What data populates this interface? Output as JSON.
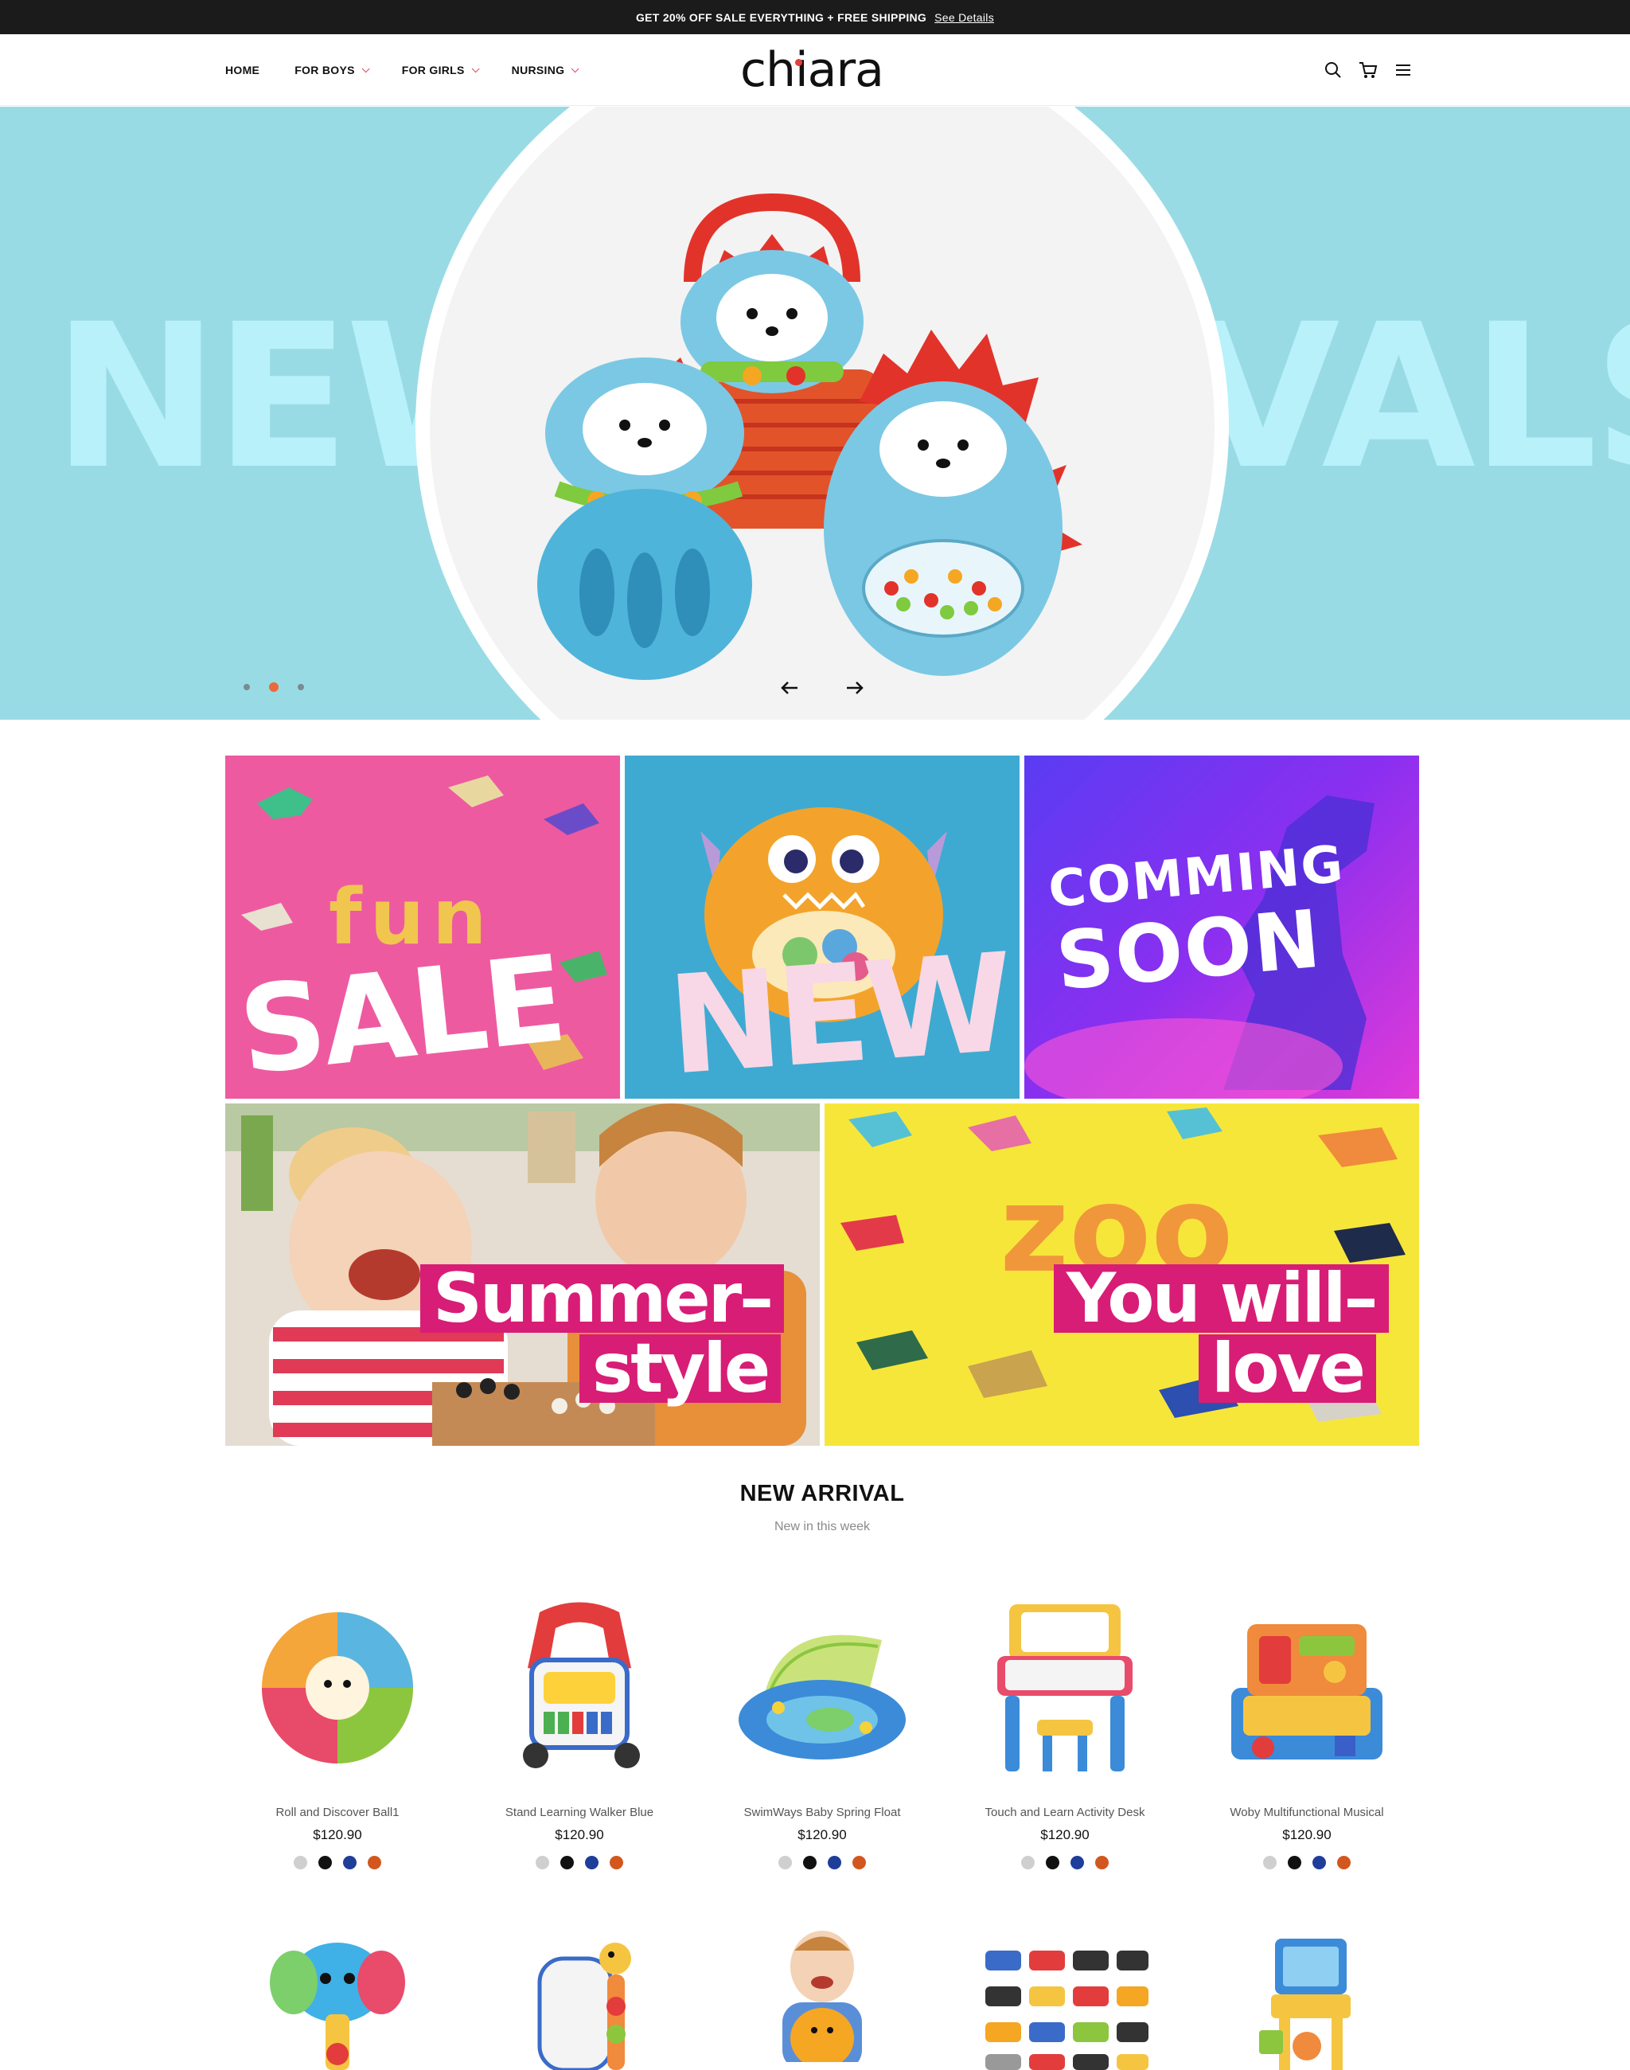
{
  "announcement": {
    "text": "GET 20% OFF SALE EVERYTHING + FREE SHIPPING",
    "link": "See Details"
  },
  "nav": {
    "items": [
      {
        "label": "HOME"
      },
      {
        "label": "FOR BOYS"
      },
      {
        "label": "FOR GIRLS"
      },
      {
        "label": "NURSING"
      }
    ]
  },
  "brand": {
    "logo": "chiara"
  },
  "header_icons": [
    "search-icon",
    "cart-icon",
    "menu-icon"
  ],
  "hero": {
    "word_left": "NEW",
    "word_right": "VALS",
    "slides": 3,
    "active_slide": 2,
    "bg_color": "#99dbe5"
  },
  "banners": {
    "b1_small": "fun",
    "b1_big": "SALE",
    "b2_big": "NEW",
    "b3_line1": "COMMING",
    "b3_line2": "SOON",
    "b4_line1": "Summer–",
    "b4_line2": "style",
    "b5_line1": "You will–",
    "b5_line2": "love",
    "accent_color": "#d81d76"
  },
  "section": {
    "title": "NEW ARRIVAL",
    "subtitle": "New in this week"
  },
  "products": [
    {
      "name": "Roll and Discover Ball1",
      "price": "$120.90"
    },
    {
      "name": "Stand Learning Walker Blue",
      "price": "$120.90"
    },
    {
      "name": "SwimWays Baby Spring Float",
      "price": "$120.90"
    },
    {
      "name": "Touch and Learn Activity Desk",
      "price": "$120.90"
    },
    {
      "name": "Woby Multifunctional Musical",
      "price": "$120.90"
    }
  ],
  "swatch_colors": [
    "#cfcfcf",
    "#111111",
    "#1f3e9a",
    "#d2571f"
  ]
}
